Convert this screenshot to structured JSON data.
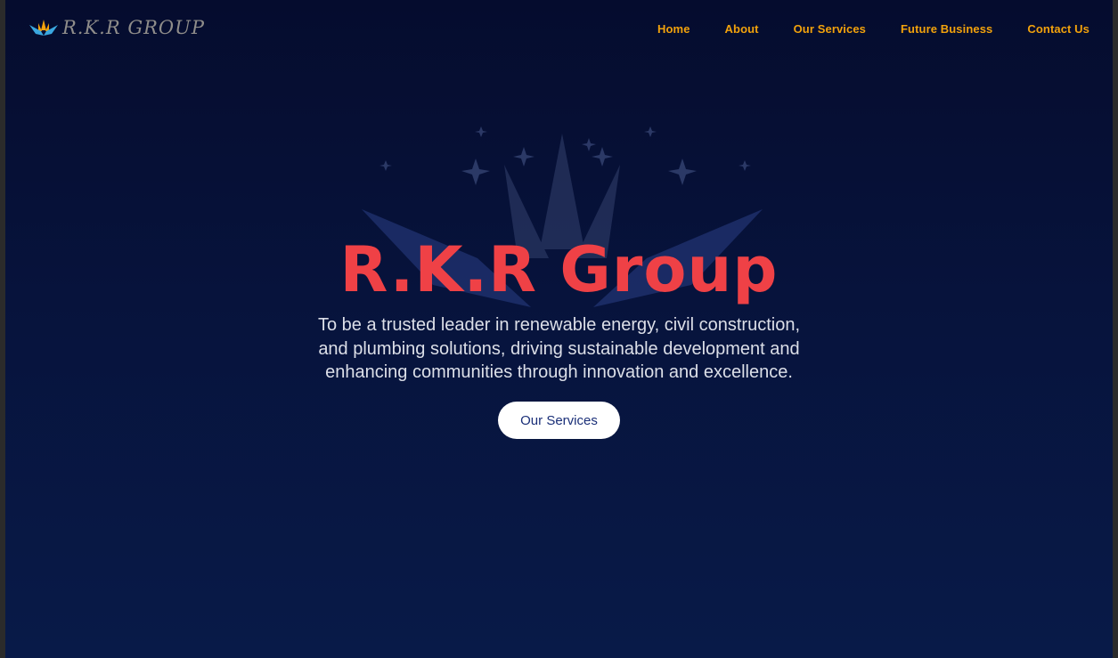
{
  "brand": {
    "logo_icon": "crown-wings-logo",
    "logo_text": "R.K.R GROUP"
  },
  "nav": {
    "items": [
      {
        "label": "Home"
      },
      {
        "label": "About"
      },
      {
        "label": "Our Services"
      },
      {
        "label": "Future Business"
      },
      {
        "label": "Contact Us"
      }
    ]
  },
  "hero": {
    "title": "R.K.R Group",
    "tagline": "To be a trusted leader in renewable energy, civil construction, and plumbing solutions, driving sustainable development and enhancing communities through innovation and excellence.",
    "cta_label": "Our Services",
    "background_icon": "crown-wings-emblem"
  },
  "colors": {
    "background": "#07133c",
    "nav_link": "#f2a20c",
    "title": "#ef4146",
    "tagline": "#dcdfe8",
    "cta_background": "#ffffff",
    "cta_text": "#1a2f78"
  }
}
